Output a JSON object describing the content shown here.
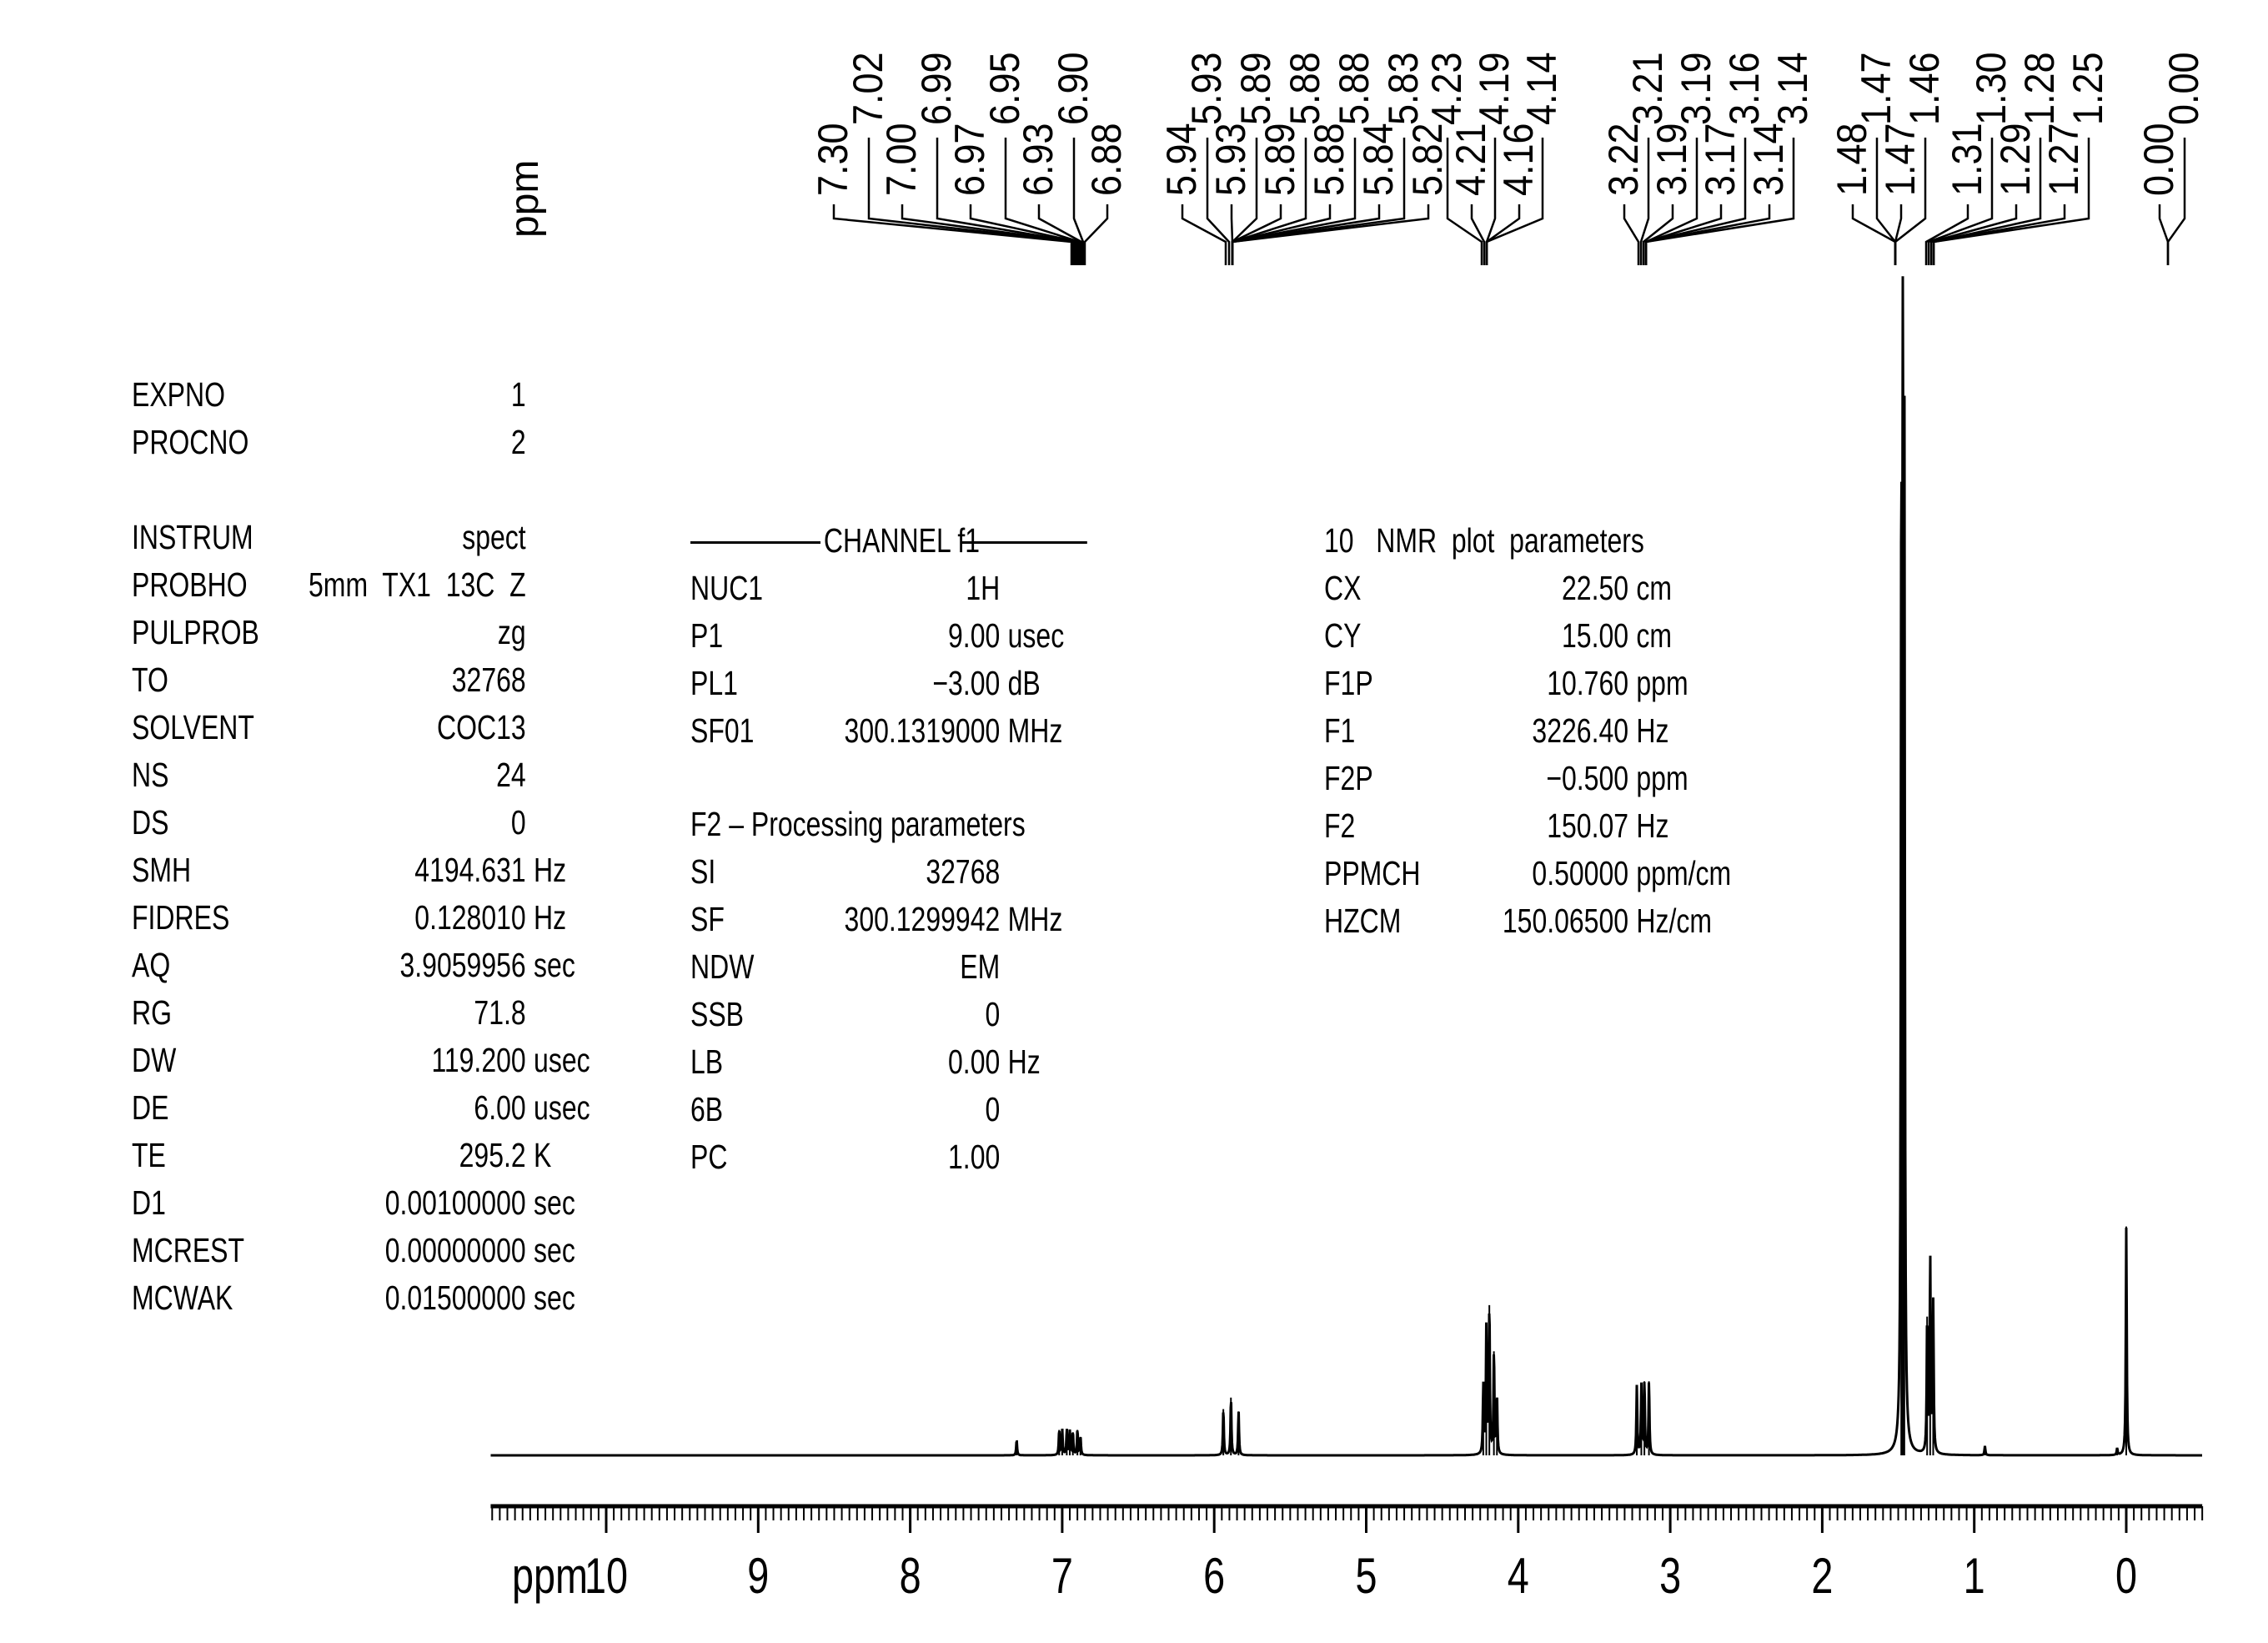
{
  "chart_data": {
    "type": "line",
    "title": "",
    "xlabel": "ppm",
    "ylabel": "",
    "xlim": [
      10.76,
      -0.5
    ],
    "x_reversed": true,
    "grid": false,
    "x_ticks": [
      10,
      9,
      8,
      7,
      6,
      5,
      4,
      3,
      2,
      1,
      0
    ],
    "x_tick_labels": [
      "10",
      "9",
      "8",
      "7",
      "6",
      "5",
      "4",
      "3",
      "2",
      "1",
      "0"
    ],
    "axis_label_prefix": "ppm",
    "vertical_axis_label": "ppm",
    "peaks_relative_height": [
      {
        "ppm": 7.3,
        "height": 0.013
      },
      {
        "ppm": 7.02,
        "height": 0.022
      },
      {
        "ppm": 7.0,
        "height": 0.022
      },
      {
        "ppm": 6.97,
        "height": 0.022
      },
      {
        "ppm": 6.95,
        "height": 0.021
      },
      {
        "ppm": 6.93,
        "height": 0.02
      },
      {
        "ppm": 6.9,
        "height": 0.022
      },
      {
        "ppm": 6.88,
        "height": 0.016
      },
      {
        "ppm": 5.94,
        "height": 0.04
      },
      {
        "ppm": 5.89,
        "height": 0.05
      },
      {
        "ppm": 5.84,
        "height": 0.038
      },
      {
        "ppm": 4.23,
        "height": 0.06
      },
      {
        "ppm": 4.21,
        "height": 0.11
      },
      {
        "ppm": 4.19,
        "height": 0.13
      },
      {
        "ppm": 4.16,
        "height": 0.09
      },
      {
        "ppm": 4.14,
        "height": 0.05
      },
      {
        "ppm": 3.22,
        "height": 0.06
      },
      {
        "ppm": 3.19,
        "height": 0.06
      },
      {
        "ppm": 3.17,
        "height": 0.064
      },
      {
        "ppm": 3.14,
        "height": 0.064
      },
      {
        "ppm": 1.48,
        "height": 0.78
      },
      {
        "ppm": 1.47,
        "height": 1.0
      },
      {
        "ppm": 1.46,
        "height": 0.82
      },
      {
        "ppm": 1.31,
        "height": 0.12
      },
      {
        "ppm": 1.29,
        "height": 0.17
      },
      {
        "ppm": 1.27,
        "height": 0.13
      },
      {
        "ppm": 0.93,
        "height": 0.008
      },
      {
        "ppm": 0.06,
        "height": 0.006
      },
      {
        "ppm": 0.0,
        "height": 0.198
      }
    ],
    "peak_label_groups": [
      {
        "lower": [
          "7.30",
          "7.00",
          "6.97",
          "6.93",
          "6.88"
        ],
        "upper": [
          "7.02",
          "6.99",
          "6.95",
          "6.90"
        ]
      },
      {
        "lower": [
          "5.94",
          "5.93",
          "5.89",
          "5.88",
          "5.84",
          "5.82"
        ],
        "upper": [
          "5.93",
          "5.89",
          "5.88",
          "5.88",
          "5.83"
        ]
      },
      {
        "lower": [
          "4.21",
          "4.16"
        ],
        "upper": [
          "4.23",
          "4.19",
          "4.14"
        ]
      },
      {
        "lower": [
          "3.22",
          "3.19",
          "3.17",
          "3.14"
        ],
        "upper": [
          "3.21",
          "3.19",
          "3.16",
          "3.14"
        ]
      },
      {
        "lower": [
          "1.48",
          "1.47"
        ],
        "upper": [
          "1.47",
          "1.46"
        ]
      },
      {
        "lower": [
          "1.31",
          "1.29",
          "1.27"
        ],
        "upper": [
          "1.30",
          "1.28",
          "1.25"
        ]
      },
      {
        "lower": [
          "0.00"
        ],
        "upper": [
          "0.00"
        ]
      }
    ]
  },
  "acquisition": {
    "rows": [
      {
        "name": "EXPNO",
        "value": "1",
        "unit": ""
      },
      {
        "name": "PROCNO",
        "value": "2",
        "unit": ""
      },
      {
        "name": "",
        "value": "",
        "unit": ""
      },
      {
        "name": "INSTRUM",
        "value": "spect",
        "unit": ""
      },
      {
        "name": "PROBHO",
        "value": "5mm  TX1  13C  Z",
        "unit": ""
      },
      {
        "name": "PULPROB",
        "value": "zg",
        "unit": ""
      },
      {
        "name": "TO",
        "value": "32768",
        "unit": ""
      },
      {
        "name": "SOLVENT",
        "value": "COC13",
        "unit": ""
      },
      {
        "name": "NS",
        "value": "24",
        "unit": ""
      },
      {
        "name": "DS",
        "value": "0",
        "unit": ""
      },
      {
        "name": "SMH",
        "value": "4194.631",
        "unit": "Hz"
      },
      {
        "name": "FIDRES",
        "value": "0.128010",
        "unit": "Hz"
      },
      {
        "name": "AQ",
        "value": "3.9059956",
        "unit": "sec"
      },
      {
        "name": "RG",
        "value": "71.8",
        "unit": ""
      },
      {
        "name": "DW",
        "value": "119.200",
        "unit": "usec"
      },
      {
        "name": "DE",
        "value": "6.00",
        "unit": "usec"
      },
      {
        "name": "TE",
        "value": "295.2",
        "unit": "K"
      },
      {
        "name": "D1",
        "value": "0.00100000",
        "unit": "sec"
      },
      {
        "name": "MCREST",
        "value": "0.00000000",
        "unit": "sec"
      },
      {
        "name": "MCWAK",
        "value": "0.01500000",
        "unit": "sec"
      }
    ]
  },
  "channel": {
    "header": "CHANNEL f1",
    "rows": [
      {
        "name": "NUC1",
        "value": "1H",
        "unit": ""
      },
      {
        "name": "P1",
        "value": "9.00",
        "unit": "usec"
      },
      {
        "name": "PL1",
        "value": "−3.00",
        "unit": "dB"
      },
      {
        "name": "SF01",
        "value": "300.1319000",
        "unit": "MHz"
      }
    ]
  },
  "processing": {
    "header": "F2 – Processing parameters",
    "rows": [
      {
        "name": "SI",
        "value": "32768",
        "unit": ""
      },
      {
        "name": "SF",
        "value": "300.1299942",
        "unit": "MHz"
      },
      {
        "name": "NDW",
        "value": "EM",
        "unit": ""
      },
      {
        "name": "SSB",
        "value": "0",
        "unit": ""
      },
      {
        "name": "LB",
        "value": "0.00",
        "unit": "Hz"
      },
      {
        "name": "6B",
        "value": "0",
        "unit": ""
      },
      {
        "name": "PC",
        "value": "1.00",
        "unit": ""
      }
    ]
  },
  "plot": {
    "header": "10   NMR  plot  parameters",
    "rows": [
      {
        "name": "CX",
        "value": "22.50",
        "unit": "cm"
      },
      {
        "name": "CY",
        "value": "15.00",
        "unit": "cm"
      },
      {
        "name": "F1P",
        "value": "10.760",
        "unit": "ppm"
      },
      {
        "name": "F1",
        "value": "3226.40",
        "unit": "Hz"
      },
      {
        "name": "F2P",
        "value": "−0.500",
        "unit": "ppm"
      },
      {
        "name": "F2",
        "value": "150.07",
        "unit": "Hz"
      },
      {
        "name": "PPMCH",
        "value": "0.50000",
        "unit": "ppm/cm"
      },
      {
        "name": "HZCM",
        "value": "150.06500",
        "unit": "Hz/cm"
      }
    ]
  }
}
